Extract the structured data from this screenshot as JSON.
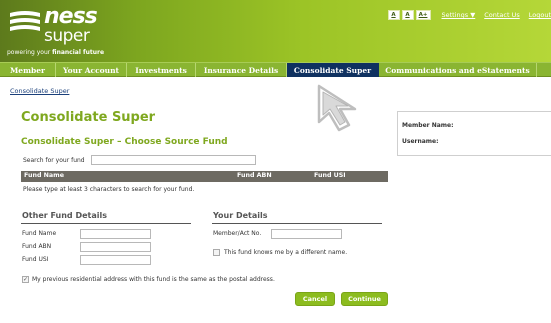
{
  "brand": {
    "name_top": "ness",
    "name_bottom": "super",
    "tagline_regular": "powering your ",
    "tagline_bold": "financial future"
  },
  "utility": {
    "font_small": "A",
    "font_medium": "A",
    "font_large": "A+",
    "settings": "Settings ▼",
    "contact": "Contact Us",
    "logout": "Logout"
  },
  "nav": {
    "items": [
      {
        "label": "Member"
      },
      {
        "label": "Your Account"
      },
      {
        "label": "Investments"
      },
      {
        "label": "Insurance Details"
      },
      {
        "label": "Consolidate Super"
      },
      {
        "label": "Communications and eStatements"
      }
    ]
  },
  "breadcrumb": "Consolidate Super",
  "main": {
    "title": "Consolidate Super",
    "subtitle": "Consolidate Super – Choose Source Fund",
    "search_label": "Search for your fund",
    "search_value": "",
    "table_headers": [
      "Fund Name",
      "Fund ABN",
      "Fund USI"
    ],
    "table_hint": "Please type at least 3 characters to search for your fund."
  },
  "other_fund": {
    "title": "Other Fund Details",
    "labels": [
      "Fund Name",
      "Fund ABN",
      "Fund USI"
    ]
  },
  "your_details": {
    "title": "Your Details",
    "member_label": "Member/Act No.",
    "alias_checkbox": "This fund knows me by a different name."
  },
  "address_checkbox": "My previous residential address with this fund is the same as the postal address.",
  "buttons": {
    "cancel": "Cancel",
    "continue": "Continue"
  },
  "side_panel": {
    "member_name_label": "Member Name:",
    "username_label": "Username:"
  },
  "colors": {
    "brand_green": "#8ab532",
    "active_nav": "#0f3160",
    "heading_green": "#7fa81f",
    "button_green": "#8cbc1f"
  }
}
